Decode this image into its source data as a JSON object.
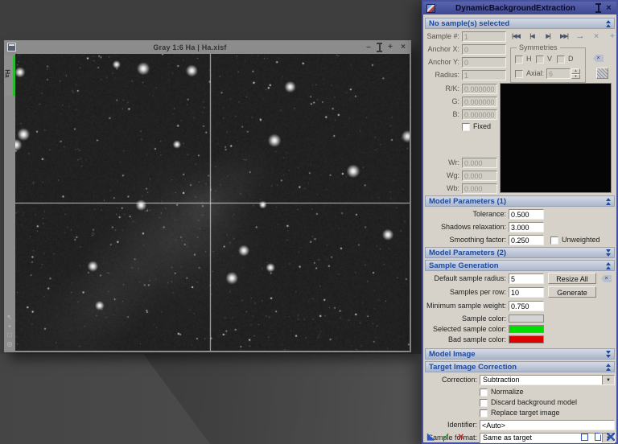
{
  "image_window": {
    "title": "Gray 1:6 Ha | Ha.xisf",
    "tab_label": "Ha"
  },
  "dialog": {
    "title": "DynamicBackgroundExtraction",
    "sections": {
      "samples": {
        "header": "No sample(s) selected",
        "sample_label": "Sample #:",
        "sample_value": "1",
        "anchor_x_label": "Anchor X:",
        "anchor_x_value": "0",
        "anchor_y_label": "Anchor Y:",
        "anchor_y_value": "0",
        "radius_label": "Radius:",
        "radius_value": "1",
        "symmetries_label": "Symmetries",
        "h_label": "H",
        "v_label": "V",
        "d_label": "D",
        "axial_label": "Axial:",
        "axial_value": "6",
        "rk_label": "R/K:",
        "rk_value": "0.000000",
        "g_label": "G:",
        "g_value": "0.000000",
        "b_label": "B:",
        "b_value": "0.000000",
        "fixed_label": "Fixed",
        "wr_label": "Wr:",
        "wr_value": "0.000",
        "wg_label": "Wg:",
        "wg_value": "0.000",
        "wb_label": "Wb:",
        "wb_value": "0.000"
      },
      "model1": {
        "header": "Model Parameters (1)",
        "tolerance_label": "Tolerance:",
        "tolerance_value": "0.500",
        "shadows_label": "Shadows relaxation:",
        "shadows_value": "3.000",
        "smoothing_label": "Smoothing factor:",
        "smoothing_value": "0.250",
        "unweighted_label": "Unweighted"
      },
      "model2": {
        "header": "Model Parameters (2)"
      },
      "sample_gen": {
        "header": "Sample Generation",
        "radius_label": "Default sample radius:",
        "radius_value": "5",
        "resize_all_label": "Resize All",
        "per_row_label": "Samples per row:",
        "per_row_value": "10",
        "generate_label": "Generate",
        "min_weight_label": "Minimum sample weight:",
        "min_weight_value": "0.750",
        "sample_color_label": "Sample color:",
        "selected_color_label": "Selected sample color:",
        "bad_color_label": "Bad sample color:",
        "colors": {
          "sample": "#d4d4d4",
          "selected": "#00dc00",
          "bad": "#dd0000"
        }
      },
      "model_image": {
        "header": "Model Image"
      },
      "target": {
        "header": "Target Image Correction",
        "correction_label": "Correction:",
        "correction_value": "Subtraction",
        "normalize_label": "Normalize",
        "discard_label": "Discard background model",
        "replace_label": "Replace target image",
        "identifier_label": "Identifier:",
        "identifier_value": "<Auto>",
        "format_label": "Sample format:",
        "format_value": "Same as target"
      }
    },
    "icons": {
      "nav_first": "|◀◀",
      "nav_prev": "|◀",
      "nav_next": "▶|",
      "nav_last": "▶▶|",
      "nav_move": "→",
      "nav_delete": "×",
      "nav_drag": "+",
      "combo_arrow": "▼",
      "spin_up": "▲",
      "spin_down": "▼",
      "new_instance": "◣",
      "execute": "✓",
      "cancel": "×",
      "del": "×",
      "win_min": "–",
      "win_max": "+",
      "win_close": "×",
      "sidebar_0": "↖",
      "sidebar_1": "+",
      "sidebar_2": "□",
      "sidebar_3": "◎"
    }
  }
}
